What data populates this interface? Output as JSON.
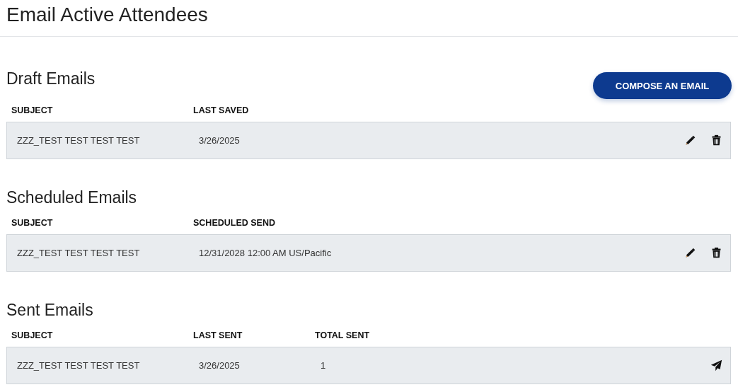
{
  "page_title": "Email Active Attendees",
  "compose_button": "COMPOSE AN EMAIL",
  "sections": [
    {
      "heading": "Draft Emails",
      "columns": [
        "SUBJECT",
        "LAST SAVED"
      ],
      "rows": [
        {
          "cells": [
            "ZZZ_TEST TEST TEST TEST",
            "3/26/2025"
          ],
          "actions": [
            {
              "kind": "edit"
            },
            {
              "kind": "delete"
            }
          ]
        }
      ]
    },
    {
      "heading": "Scheduled Emails",
      "columns": [
        "SUBJECT",
        "SCHEDULED SEND"
      ],
      "rows": [
        {
          "cells": [
            "ZZZ_TEST TEST TEST TEST",
            "12/31/2028 12:00 AM US/Pacific"
          ],
          "actions": [
            {
              "kind": "edit"
            },
            {
              "kind": "delete"
            }
          ]
        }
      ]
    },
    {
      "heading": "Sent Emails",
      "columns": [
        "SUBJECT",
        "LAST SENT",
        "TOTAL SENT"
      ],
      "rows": [
        {
          "cells": [
            "ZZZ_TEST TEST TEST TEST",
            "3/26/2025",
            "1"
          ],
          "actions": [
            {
              "kind": "send"
            }
          ]
        }
      ]
    }
  ]
}
